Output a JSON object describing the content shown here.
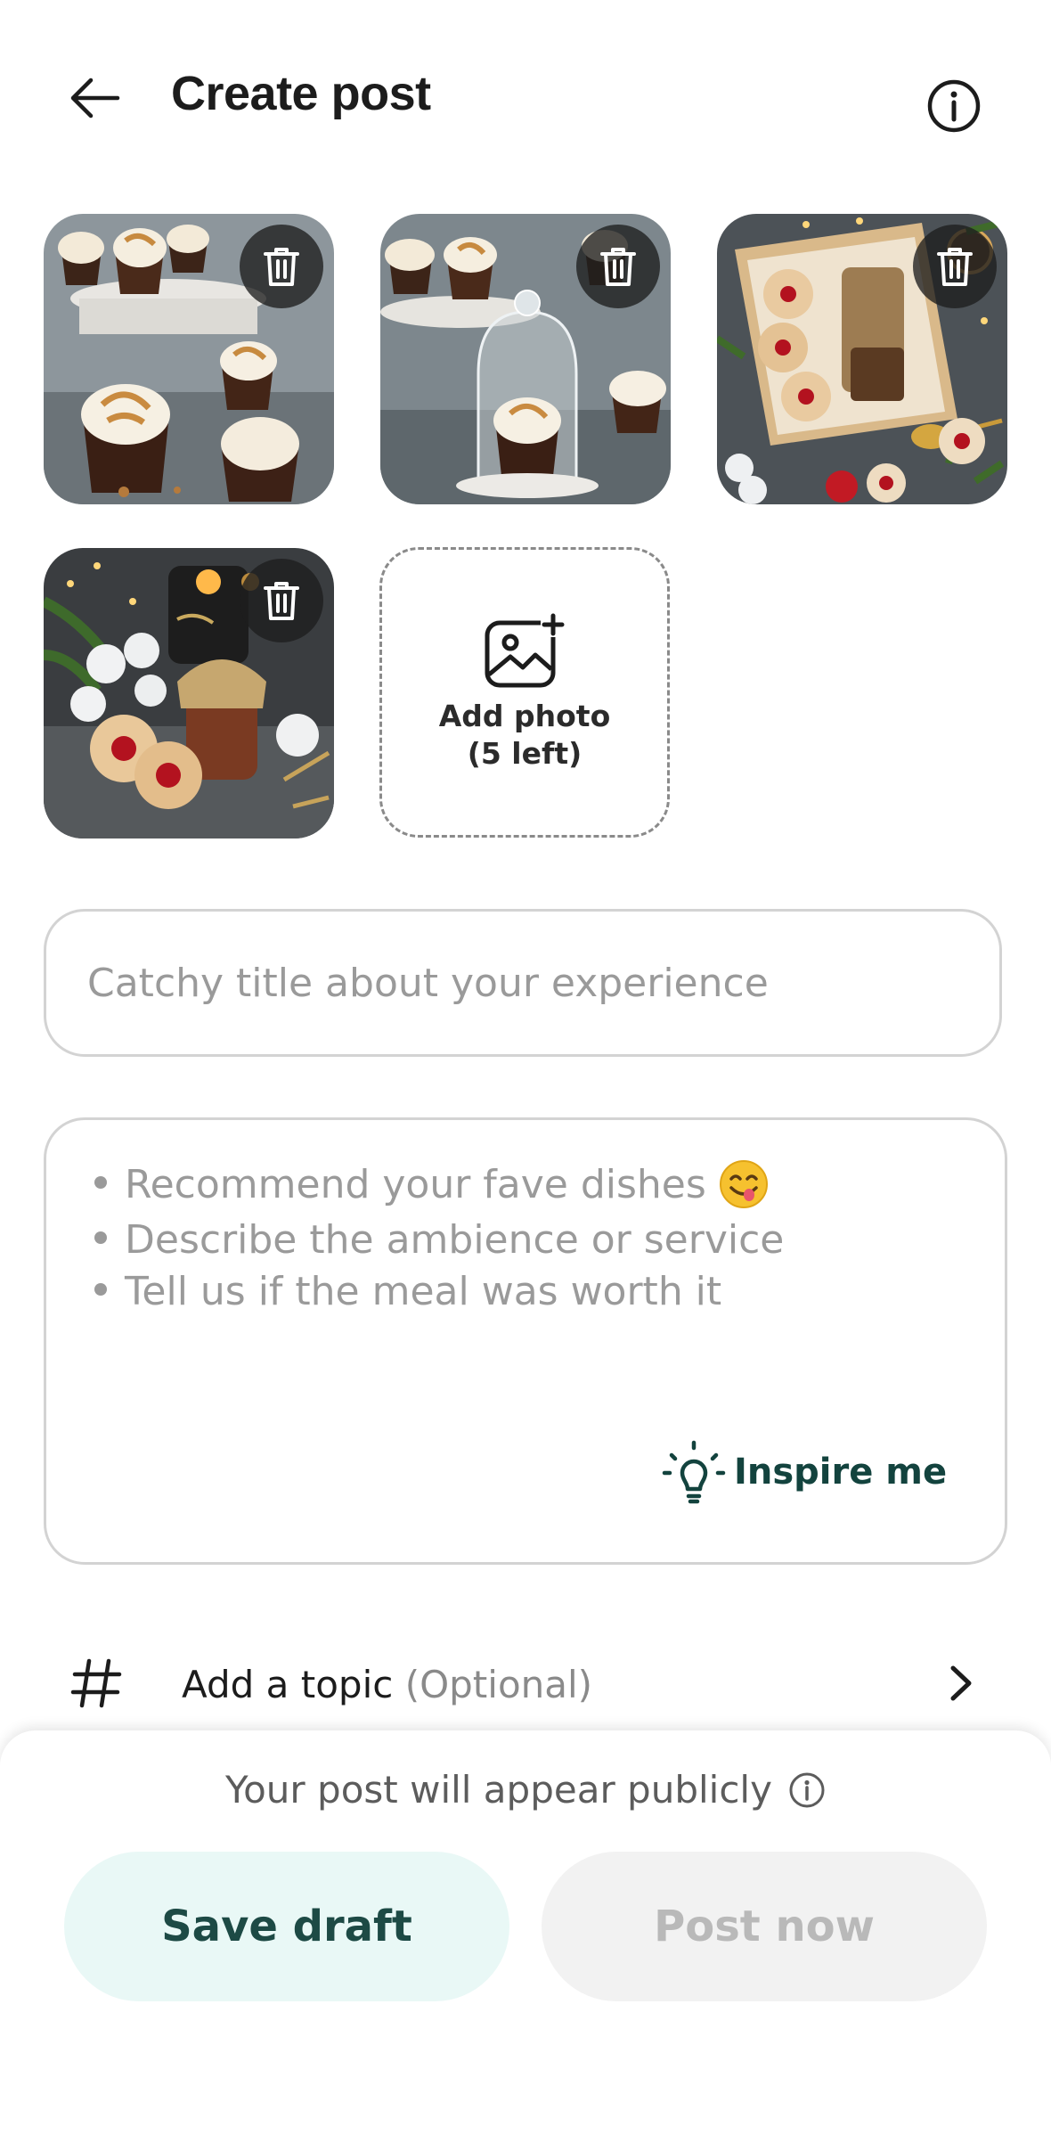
{
  "header": {
    "title": "Create post",
    "back_icon": "arrow-left-icon",
    "info_icon": "info-icon"
  },
  "photos": [
    {
      "subject": "cupcakes-on-stand",
      "delete_icon": "trash-icon"
    },
    {
      "subject": "cupcake-under-glass-dome",
      "delete_icon": "trash-icon"
    },
    {
      "subject": "jam-cookies-in-box",
      "delete_icon": "trash-icon"
    },
    {
      "subject": "jam-cookies-and-jar",
      "delete_icon": "trash-icon"
    }
  ],
  "add_photo": {
    "label_line1": "Add photo",
    "label_line2": "(5 left)",
    "icon": "image-add-icon"
  },
  "title_field": {
    "placeholder": "Catchy title about your experience",
    "value": ""
  },
  "body_field": {
    "hints": [
      "Recommend your fave dishes",
      "Describe the ambience or service",
      "Tell us if the meal was worth it"
    ],
    "emoji": "😋",
    "inspire_label": "Inspire me",
    "inspire_icon": "lightbulb-icon"
  },
  "topic": {
    "label": "Add a topic",
    "optional": "(Optional)",
    "icon": "hash-icon",
    "chevron": "chevron-right-icon"
  },
  "footer": {
    "notice": "Your post will appear publicly",
    "save_label": "Save draft",
    "post_label": "Post now"
  },
  "colors": {
    "accent_text": "#13433e",
    "save_bg": "#e9f8f6",
    "post_disabled_bg": "#f2f2f2",
    "placeholder": "#9a9a9a"
  }
}
